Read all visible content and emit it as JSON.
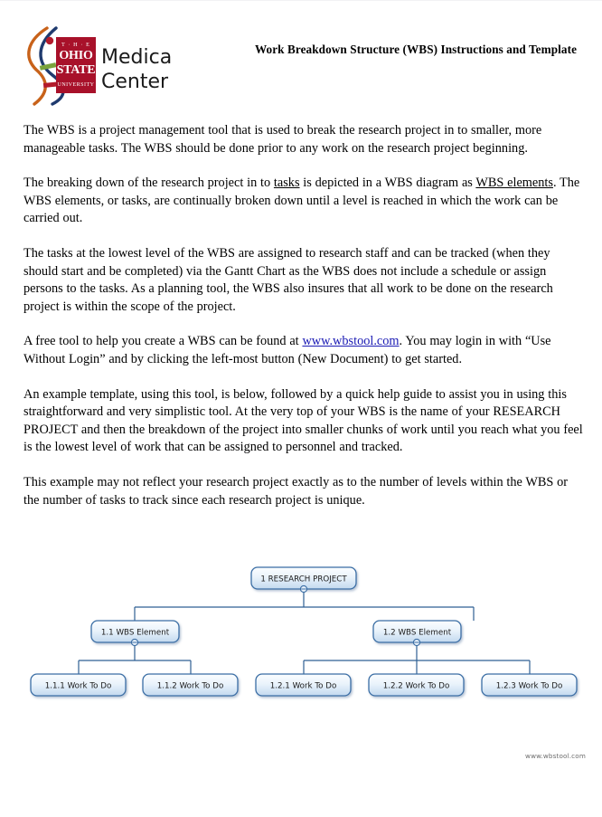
{
  "document": {
    "title": "Work Breakdown Structure (WBS) Instructions and Template",
    "logo": {
      "institution_line1": "Medical",
      "institution_line2": "Center",
      "seal_the": "T · H · E",
      "seal_ohio": "OHIO",
      "seal_state": "STATE",
      "seal_university": "UNIVERSITY",
      "colors": {
        "seal_red": "#a8112a",
        "helix_blue": "#1f3a6e",
        "helix_orange": "#c8621a",
        "helix_green": "#7aa33c",
        "helix_red": "#b31b2c",
        "wordmark": "#1a1a1a"
      }
    },
    "paragraphs": [
      {
        "id": "p1",
        "runs": [
          {
            "text": "The WBS is a project management tool that is used to break the research project in to smaller, more manageable tasks.  The WBS should be done prior to any work on the research project beginning.",
            "style": "plain"
          }
        ]
      },
      {
        "id": "p2",
        "runs": [
          {
            "text": "The breaking down of the research project in to ",
            "style": "plain"
          },
          {
            "text": "tasks",
            "style": "underline"
          },
          {
            "text": " is depicted in a WBS diagram as ",
            "style": "plain"
          },
          {
            "text": "WBS elements",
            "style": "underline"
          },
          {
            "text": ".  The WBS elements, or tasks, are continually broken down until a level is reached in which the work can be carried out.",
            "style": "plain"
          }
        ]
      },
      {
        "id": "p3",
        "runs": [
          {
            "text": "The tasks at the lowest level of the WBS are assigned to research staff and can be tracked (when they should start and be completed) via the Gantt Chart as the WBS does not include a schedule or assign persons to the tasks.  As a planning tool, the WBS also insures that all work to be done on the research project is within the scope of the project.",
            "style": "plain"
          }
        ]
      },
      {
        "id": "p4",
        "runs": [
          {
            "text": "A free tool to help you create a WBS can be found at ",
            "style": "plain"
          },
          {
            "text": "www.wbstool.com",
            "style": "link"
          },
          {
            "text": ".  You may login in with “Use Without Login” and by clicking the left-most button (New Document) to get started.",
            "style": "plain"
          }
        ]
      },
      {
        "id": "p5",
        "runs": [
          {
            "text": "An example template, using this tool, is below, followed by a quick help guide to assist you in using this straightforward and very simplistic tool.  At the very top of your WBS is the name of your RESEARCH PROJECT and then the breakdown of the project into smaller chunks of work until you reach what you feel is the lowest level of work that can be assigned to personnel and tracked.",
            "style": "plain"
          }
        ]
      },
      {
        "id": "p6",
        "runs": [
          {
            "text": "This example may not reflect your research project exactly as to the number of levels within the WBS or the number of tasks to track since each research project is unique.",
            "style": "plain"
          }
        ]
      }
    ],
    "footer_note": "www.wbstool.com"
  },
  "wbs_diagram": {
    "node_fill_top": "#f5f9fd",
    "node_fill_bottom": "#c9ddf0",
    "node_stroke": "#3b6ea5",
    "connector_stroke": "#2f5f93",
    "nodes": {
      "root": {
        "label": "1 RESEARCH PROJECT",
        "level": 0
      },
      "e1": {
        "label": "1.1 WBS Element",
        "level": 1
      },
      "e2": {
        "label": "1.2 WBS Element",
        "level": 1
      },
      "t11": {
        "label": "1.1.1 Work To Do",
        "level": 2
      },
      "t12": {
        "label": "1.1.2 Work To Do",
        "level": 2
      },
      "t21": {
        "label": "1.2.1 Work To Do",
        "level": 2
      },
      "t22": {
        "label": "1.2.2 Work To Do",
        "level": 2
      },
      "t23": {
        "label": "1.2.3 Work To Do",
        "level": 2
      }
    }
  }
}
